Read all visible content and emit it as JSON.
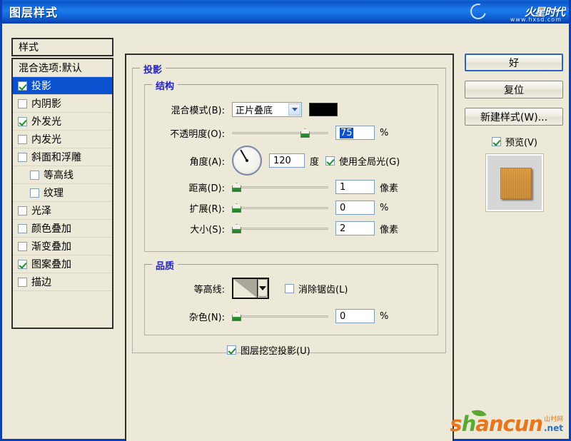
{
  "window": {
    "title": "图层样式",
    "logo": {
      "name": "火星时代",
      "badge": "代",
      "url": "www.hxsd.com"
    }
  },
  "styles_panel": {
    "header": "样式",
    "items": [
      {
        "label": "混合选项:默认",
        "checkbox": false,
        "checked": false,
        "selected": false,
        "indent": false
      },
      {
        "label": "投影",
        "checkbox": true,
        "checked": true,
        "selected": true,
        "indent": false
      },
      {
        "label": "内阴影",
        "checkbox": true,
        "checked": false,
        "selected": false,
        "indent": false
      },
      {
        "label": "外发光",
        "checkbox": true,
        "checked": true,
        "selected": false,
        "indent": false
      },
      {
        "label": "内发光",
        "checkbox": true,
        "checked": false,
        "selected": false,
        "indent": false
      },
      {
        "label": "斜面和浮雕",
        "checkbox": true,
        "checked": false,
        "selected": false,
        "indent": false
      },
      {
        "label": "等高线",
        "checkbox": true,
        "checked": false,
        "selected": false,
        "indent": true
      },
      {
        "label": "纹理",
        "checkbox": true,
        "checked": false,
        "selected": false,
        "indent": true
      },
      {
        "label": "光泽",
        "checkbox": true,
        "checked": false,
        "selected": false,
        "indent": false
      },
      {
        "label": "颜色叠加",
        "checkbox": true,
        "checked": false,
        "selected": false,
        "indent": false
      },
      {
        "label": "渐变叠加",
        "checkbox": true,
        "checked": false,
        "selected": false,
        "indent": false
      },
      {
        "label": "图案叠加",
        "checkbox": true,
        "checked": true,
        "selected": false,
        "indent": false
      },
      {
        "label": "描边",
        "checkbox": true,
        "checked": false,
        "selected": false,
        "indent": false
      }
    ]
  },
  "main": {
    "group_title": "投影",
    "structure": {
      "title": "结构",
      "blend_mode": {
        "label": "混合模式(B):",
        "value": "正片叠底",
        "color": "#000000"
      },
      "opacity": {
        "label": "不透明度(O):",
        "value": "75",
        "unit": "%",
        "slider_pct": 75,
        "selected": true
      },
      "angle": {
        "label": "角度(A):",
        "value": "120",
        "unit": "度",
        "dial_degrees": 120,
        "global_light": {
          "label": "使用全局光(G)",
          "checked": true
        }
      },
      "distance": {
        "label": "距离(D):",
        "value": "1",
        "unit": "像素",
        "slider_pct": 1
      },
      "spread": {
        "label": "扩展(R):",
        "value": "0",
        "unit": "%",
        "slider_pct": 0
      },
      "size": {
        "label": "大小(S):",
        "value": "2",
        "unit": "像素",
        "slider_pct": 2
      }
    },
    "quality": {
      "title": "品质",
      "contour": {
        "label": "等高线:",
        "preview": "linear-ramp"
      },
      "anti_alias": {
        "label": "消除锯齿(L)",
        "checked": false
      },
      "noise": {
        "label": "杂色(N):",
        "value": "0",
        "unit": "%",
        "slider_pct": 0
      }
    },
    "knockout": {
      "label": "图层挖空投影(U)",
      "checked": true
    }
  },
  "buttons": {
    "ok": "好",
    "reset": "复位",
    "new_style": "新建样式(W)...",
    "preview": {
      "label": "预览(V)",
      "checked": true
    }
  },
  "watermark": {
    "s": "s",
    "h": "h",
    "a": "a",
    "n": "n",
    "c": "c",
    "u": "u",
    "n2": "n",
    "cn": "山村网",
    "net": ".net"
  }
}
